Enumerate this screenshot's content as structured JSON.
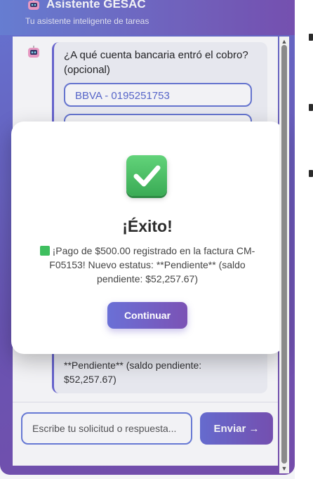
{
  "header": {
    "title": "Asistente GESAC",
    "subtitle": "Tu asistente inteligente de tareas"
  },
  "chat": {
    "question": "¿A qué cuenta bancaria entró el cobro? (opcional)",
    "options": [
      "BBVA - 0195251753"
    ],
    "partial_text": "**Pendiente** (saldo pendiente: $52,257.67)"
  },
  "input": {
    "placeholder": "Escribe tu solicitud o respuesta...",
    "send_label": "Enviar →"
  },
  "modal": {
    "title": "¡Éxito!",
    "message": "¡Pago de $500.00 registrado en la factura CM-F05153! Nuevo estatus: **Pendiente** (saldo pendiente: $52,257.67)",
    "button": "Continuar"
  },
  "colors": {
    "accent": "#6a70d6",
    "accent_dark": "#7b52b5",
    "success": "#3fbf5f"
  }
}
